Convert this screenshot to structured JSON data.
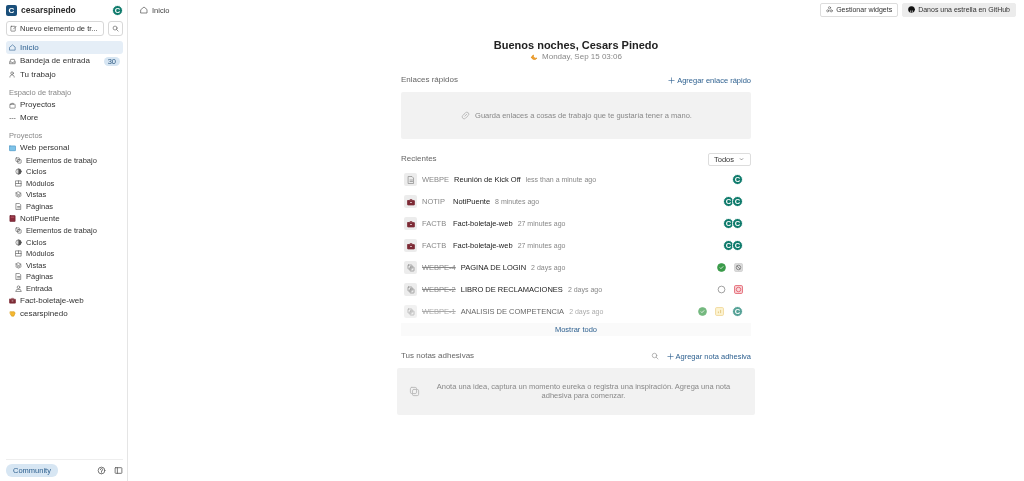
{
  "sidebar": {
    "workspace": {
      "initial": "C",
      "name": "cesarspinedo",
      "user_initial": "C"
    },
    "new_item": {
      "label": "Nuevo elemento de tr..."
    },
    "nav": [
      {
        "label": "Inicio",
        "selected": true
      },
      {
        "label": "Bandeja de entrada",
        "selected": false,
        "badge": "30"
      },
      {
        "label": "Tu trabajo",
        "selected": false
      }
    ],
    "workspace_section": {
      "title": "Espacio de trabajo",
      "items": [
        {
          "label": "Proyectos"
        },
        {
          "label": "More"
        }
      ]
    },
    "projects_section": {
      "title": "Proyectos",
      "projects": [
        {
          "label": "Web personal",
          "children": [
            {
              "label": "Elementos de trabajo"
            },
            {
              "label": "Ciclos"
            },
            {
              "label": "Módulos"
            },
            {
              "label": "Vistas"
            },
            {
              "label": "Páginas"
            }
          ]
        },
        {
          "label": "NotiPuente",
          "children": [
            {
              "label": "Elementos de trabajo"
            },
            {
              "label": "Ciclos"
            },
            {
              "label": "Módulos"
            },
            {
              "label": "Vistas"
            },
            {
              "label": "Páginas"
            },
            {
              "label": "Entrada"
            }
          ]
        },
        {
          "label": "Fact-boletaje-web"
        },
        {
          "label": "cesarspinedo"
        }
      ]
    },
    "footer": {
      "community": "Community"
    }
  },
  "topbar": {
    "breadcrumb": "Inicio",
    "buttons": [
      {
        "label": "Gestionar widgets",
        "kind": "widgets"
      },
      {
        "label": "Danos una estrella en GitHub",
        "kind": "github"
      }
    ]
  },
  "greeting": {
    "title": "Buenos noches, Cesars Pinedo",
    "date": "Monday, Sep 15 03:06"
  },
  "quick_links": {
    "title": "Enlaces rápidos",
    "action": "Agregar enlace rápido",
    "empty": "Guarda enlaces a cosas de trabajo que te gustaría tener a mano."
  },
  "recents": {
    "title": "Recientes",
    "filter": "Todos",
    "show_all": "Mostrar todo",
    "rows": [
      {
        "kind": "page",
        "id": "WEBPE",
        "name": "Reunión de Kick Off",
        "time": "less than a minute ago",
        "struck": false,
        "faded": false,
        "indicators": [
          {
            "kind": "avatar",
            "text": "C"
          }
        ]
      },
      {
        "kind": "project",
        "id": "NOTIP",
        "name": "NotiPuente",
        "time": "8 minutes ago",
        "struck": false,
        "faded": false,
        "indicators": [
          {
            "kind": "avatar",
            "text": "C"
          },
          {
            "kind": "avatar",
            "text": "C"
          }
        ]
      },
      {
        "kind": "project",
        "id": "FACTB",
        "name": "Fact-boletaje-web",
        "time": "27 minutes ago",
        "struck": false,
        "faded": false,
        "indicators": [
          {
            "kind": "avatar",
            "text": "C"
          },
          {
            "kind": "avatar",
            "text": "C"
          }
        ]
      },
      {
        "kind": "project",
        "id": "FACTB",
        "name": "Fact-boletaje-web",
        "time": "27 minutes ago",
        "struck": false,
        "faded": false,
        "indicators": [
          {
            "kind": "avatar",
            "text": "C"
          },
          {
            "kind": "avatar",
            "text": "C"
          }
        ]
      },
      {
        "kind": "issue",
        "id": "WEBPE-4",
        "name": "PAGINA DE LOGIN",
        "time": "2 days ago",
        "struck": true,
        "faded": false,
        "indicators": [
          {
            "kind": "done"
          },
          {
            "kind": "no-priority"
          }
        ]
      },
      {
        "kind": "issue",
        "id": "WEBPE-2",
        "name": "LIBRO DE RECLAMACIONES",
        "time": "2 days ago",
        "struck": true,
        "faded": false,
        "indicators": [
          {
            "kind": "todo"
          },
          {
            "kind": "urgent"
          }
        ]
      },
      {
        "kind": "issue",
        "id": "WEBPE-1",
        "name": "ANALISIS DE COMPETENCIA",
        "time": "2 days ago",
        "struck": true,
        "faded": true,
        "indicators": [
          {
            "kind": "done"
          },
          {
            "kind": "medium"
          },
          {
            "kind": "avatar",
            "text": "C"
          }
        ]
      }
    ]
  },
  "sticky_notes": {
    "title": "Tus notas adhesivas",
    "action": "Agregar nota adhesiva",
    "empty": "Anota una idea, captura un momento eureka o registra una inspiración. Agrega una nota adhesiva para comenzar."
  }
}
